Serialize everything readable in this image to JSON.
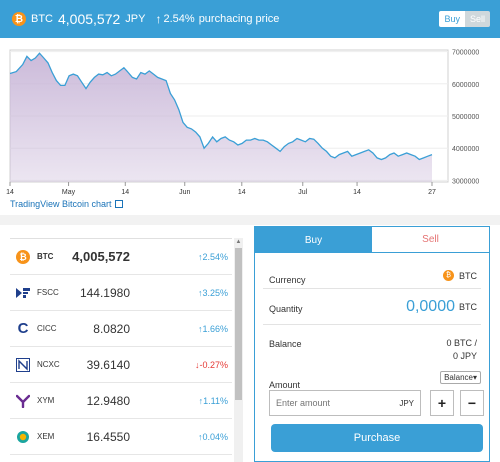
{
  "header": {
    "symbol": "BTC",
    "price": "4,005,572",
    "currency": "JPY",
    "change": "2.54%",
    "label": "purchacing price",
    "toggle_buy": "Buy",
    "toggle_sell": "Sell",
    "bg_color": "#3a9fd6"
  },
  "chart_data": {
    "type": "area",
    "x_ticks": [
      "14",
      "May",
      "14",
      "Jun",
      "14",
      "Jul",
      "14",
      "27"
    ],
    "y_ticks": [
      "7000000",
      "6000000",
      "5000000",
      "4000000",
      "3000000"
    ],
    "ylim": [
      2950000,
      7050000
    ],
    "x_range": [
      0,
      100
    ],
    "x_tick_positions": [
      0,
      19.3,
      38,
      57.6,
      76.4,
      96.5,
      114.4,
      139.1
    ],
    "line_color": "#3a9fd6",
    "fill_color": "#c9b7d8",
    "points": [
      [
        0,
        6320000
      ],
      [
        1.5,
        6380000
      ],
      [
        3,
        6600000
      ],
      [
        4,
        6850000
      ],
      [
        5,
        6720000
      ],
      [
        6,
        6800000
      ],
      [
        7,
        6950000
      ],
      [
        8,
        6800000
      ],
      [
        9,
        6650000
      ],
      [
        10,
        6350000
      ],
      [
        11,
        6100000
      ],
      [
        12,
        5950000
      ],
      [
        13,
        5950000
      ],
      [
        14,
        6250000
      ],
      [
        15,
        6300000
      ],
      [
        16,
        6250000
      ],
      [
        17,
        6050000
      ],
      [
        18,
        5850000
      ],
      [
        19,
        6050000
      ],
      [
        20,
        6200000
      ],
      [
        21,
        6300000
      ],
      [
        22,
        6280000
      ],
      [
        23,
        6350000
      ],
      [
        24,
        6250000
      ],
      [
        25,
        6300000
      ],
      [
        26,
        6400000
      ],
      [
        27,
        6500000
      ],
      [
        28,
        6350000
      ],
      [
        29,
        6200000
      ],
      [
        30,
        6150000
      ],
      [
        31,
        6350000
      ],
      [
        32,
        6300000
      ],
      [
        33,
        6400000
      ],
      [
        34,
        6300000
      ],
      [
        35,
        6200000
      ],
      [
        36,
        6150000
      ],
      [
        37,
        6100000
      ],
      [
        38,
        5700000
      ],
      [
        39,
        5500000
      ],
      [
        40,
        5200000
      ],
      [
        41,
        4800000
      ],
      [
        42,
        4650000
      ],
      [
        43,
        4600000
      ],
      [
        44,
        4500000
      ],
      [
        45,
        4350000
      ],
      [
        46,
        4000000
      ],
      [
        47,
        4150000
      ],
      [
        48,
        4350000
      ],
      [
        49,
        4200000
      ],
      [
        50,
        4300000
      ],
      [
        51,
        4350000
      ],
      [
        52,
        4250000
      ],
      [
        53,
        4200000
      ],
      [
        54,
        4100000
      ],
      [
        55,
        4150000
      ],
      [
        56,
        4250000
      ],
      [
        57,
        4250000
      ],
      [
        58,
        4300000
      ],
      [
        59,
        4250000
      ],
      [
        60,
        4250000
      ],
      [
        61,
        4200000
      ],
      [
        62,
        4100000
      ],
      [
        63,
        4000000
      ],
      [
        64,
        3900000
      ],
      [
        65,
        4050000
      ],
      [
        66,
        4150000
      ],
      [
        67,
        4200000
      ],
      [
        68,
        4300000
      ],
      [
        69,
        4250000
      ],
      [
        70,
        4200000
      ],
      [
        71,
        4300000
      ],
      [
        72,
        4280000
      ],
      [
        73,
        4150000
      ],
      [
        74,
        4000000
      ],
      [
        75,
        3900000
      ],
      [
        76,
        3750000
      ],
      [
        77,
        3700000
      ],
      [
        78,
        3800000
      ],
      [
        79,
        3850000
      ],
      [
        80,
        3900000
      ],
      [
        81,
        3750000
      ],
      [
        82,
        3800000
      ],
      [
        83,
        3850000
      ],
      [
        84,
        3900000
      ],
      [
        85,
        3950000
      ],
      [
        86,
        3850000
      ],
      [
        87,
        3700000
      ],
      [
        88,
        3650000
      ],
      [
        89,
        3700000
      ],
      [
        90,
        3800000
      ],
      [
        91,
        3850000
      ],
      [
        92,
        3750000
      ],
      [
        93,
        3800000
      ],
      [
        94,
        3850000
      ],
      [
        95,
        3800000
      ],
      [
        96,
        3750000
      ],
      [
        97,
        3650000
      ],
      [
        98,
        3700000
      ],
      [
        99,
        3750000
      ],
      [
        100,
        3800000
      ]
    ]
  },
  "chart_link": "TradingView Bitcoin chart",
  "coins": [
    {
      "symbol": "BTC",
      "value": "4,005,572",
      "change": "2.54%",
      "dir": "up"
    },
    {
      "symbol": "FSCC",
      "value": "144.1980",
      "change": "3.25%",
      "dir": "up"
    },
    {
      "symbol": "CICC",
      "value": "8.0820",
      "change": "1.66%",
      "dir": "up"
    },
    {
      "symbol": "NCXC",
      "value": "39.6140",
      "change": "-0.27%",
      "dir": "down"
    },
    {
      "symbol": "XYM",
      "value": "12.9480",
      "change": "1.11%",
      "dir": "up"
    },
    {
      "symbol": "XEM",
      "value": "16.4550",
      "change": "0.04%",
      "dir": "up"
    }
  ],
  "panel": {
    "tab_buy": "Buy",
    "tab_sell": "Sell",
    "currency_label": "Currency",
    "currency_value": "BTC",
    "quantity_label": "Quantity",
    "quantity_value": "0,0000",
    "quantity_unit": "BTC",
    "balance_label": "Balance",
    "balance_btc": "0 BTC /",
    "balance_jpy": "0 JPY",
    "amount_label": "Amount",
    "balance_select": "Balance▾",
    "amount_placeholder": "Enter amount",
    "amount_unit": "JPY",
    "plus": "+",
    "minus": "−",
    "purchase_label": "Purchase"
  }
}
